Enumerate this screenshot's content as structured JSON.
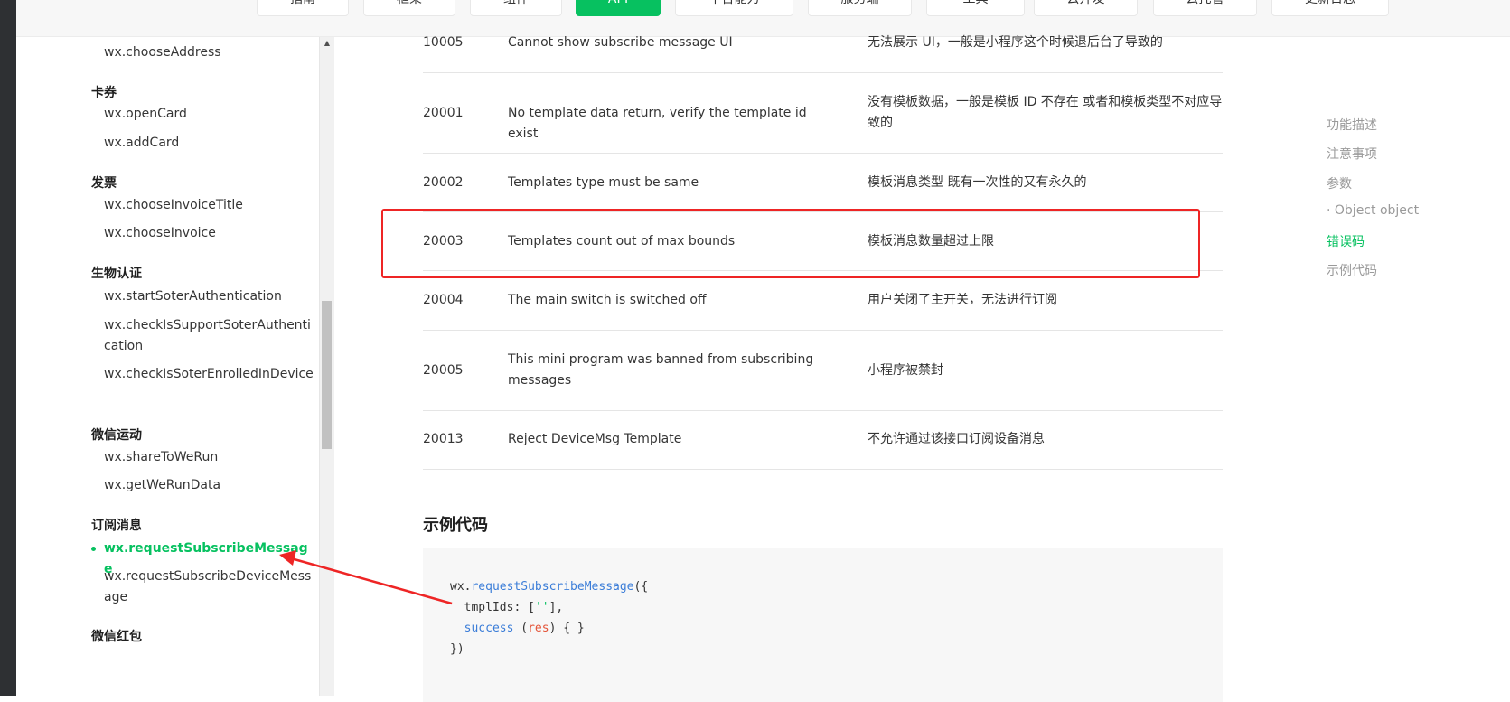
{
  "topnav": {
    "tabs": [
      {
        "label": "指南",
        "active": false
      },
      {
        "label": "框架",
        "active": false
      },
      {
        "label": "组件",
        "active": false
      },
      {
        "label": "API",
        "active": true
      },
      {
        "label": "平台能力",
        "active": false
      },
      {
        "label": "服务端",
        "active": false
      },
      {
        "label": "工具",
        "active": false
      },
      {
        "label": "云开发",
        "active": false
      },
      {
        "label": "云托管",
        "active": false
      },
      {
        "label": "更新日志",
        "active": false
      }
    ]
  },
  "sidebar": {
    "items": [
      {
        "type": "item",
        "label": "wx.chooseAddress"
      },
      {
        "type": "group",
        "label": "卡券"
      },
      {
        "type": "item",
        "label": "wx.openCard"
      },
      {
        "type": "item",
        "label": "wx.addCard"
      },
      {
        "type": "group",
        "label": "发票"
      },
      {
        "type": "item",
        "label": "wx.chooseInvoiceTitle"
      },
      {
        "type": "item",
        "label": "wx.chooseInvoice"
      },
      {
        "type": "group",
        "label": "生物认证"
      },
      {
        "type": "item",
        "label": "wx.startSoterAuthentication"
      },
      {
        "type": "item",
        "label": "wx.checkIsSupportSoterAuthentication"
      },
      {
        "type": "item",
        "label": "wx.checkIsSoterEnrolledInDevice"
      },
      {
        "type": "group",
        "label": "微信运动"
      },
      {
        "type": "item",
        "label": "wx.shareToWeRun"
      },
      {
        "type": "item",
        "label": "wx.getWeRunData"
      },
      {
        "type": "group",
        "label": "订阅消息"
      },
      {
        "type": "item",
        "label": "wx.requestSubscribeMessage",
        "active": true
      },
      {
        "type": "item",
        "label": "wx.requestSubscribeDeviceMessage"
      },
      {
        "type": "group",
        "label": "微信红包"
      }
    ]
  },
  "error_table": {
    "rows": [
      {
        "code": "10005",
        "en": "Cannot show subscribe message UI",
        "zh": "无法展示 UI，一般是小程序这个时候退后台了导致的"
      },
      {
        "code": "20001",
        "en": "No template data return, verify the template id exist",
        "zh": "没有模板数据，一般是模板 ID 不存在 或者和模板类型不对应导致的"
      },
      {
        "code": "20002",
        "en": "Templates type must be same",
        "zh": "模板消息类型 既有一次性的又有永久的"
      },
      {
        "code": "20003",
        "en": "Templates count out of max bounds",
        "zh": "模板消息数量超过上限"
      },
      {
        "code": "20004",
        "en": "The main switch is switched off",
        "zh": "用户关闭了主开关，无法进行订阅"
      },
      {
        "code": "20005",
        "en": "This mini program was banned from subscribing messages",
        "zh": "小程序被禁封"
      },
      {
        "code": "20013",
        "en": "Reject DeviceMsg Template",
        "zh": "不允许通过该接口订阅设备消息"
      }
    ]
  },
  "example": {
    "title": "示例代码",
    "code": {
      "obj": "wx.",
      "fn": "requestSubscribeMessage",
      "open": "({",
      "tmpl_key": "tmplIds",
      "tmpl_sep": ": [",
      "tmpl_str": "''",
      "tmpl_end": "],",
      "success_key": "success",
      "success_paren_open": " (",
      "success_param": "res",
      "success_body": ") { }",
      "close": "})"
    }
  },
  "toc": {
    "items": [
      {
        "label": "功能描述",
        "active": false
      },
      {
        "label": "注意事项",
        "active": false
      },
      {
        "label": "参数",
        "active": false
      },
      {
        "label": "· Object object",
        "active": false
      },
      {
        "label": "错误码",
        "active": true
      },
      {
        "label": "示例代码",
        "active": false
      }
    ]
  },
  "colors": {
    "accent": "#07c160",
    "annotation": "#ee2525"
  }
}
